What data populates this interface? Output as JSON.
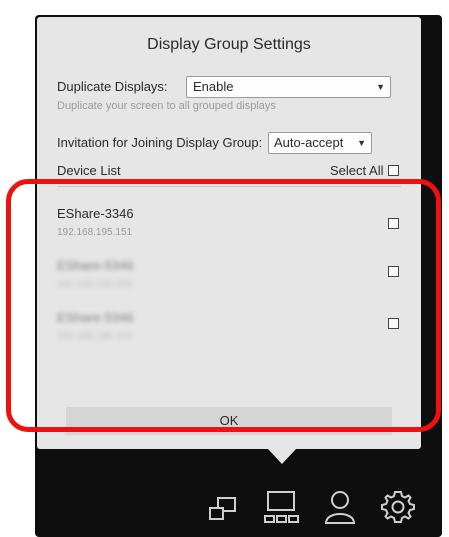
{
  "dialog": {
    "title": "Display Group Settings",
    "duplicate_label": "Duplicate Displays:",
    "duplicate_value": "Enable",
    "duplicate_hint": "Duplicate your screen to all grouped displays",
    "invitation_label": "Invitation for Joining Display Group:",
    "invitation_value": "Auto-accept",
    "device_list_label": "Device List",
    "select_all_label": "Select All",
    "ok_label": "OK"
  },
  "devices": [
    {
      "name": "EShare-3346",
      "ip": "192.168.195.151"
    },
    {
      "name": "EShare-5346",
      "ip": "192.168.195.152"
    },
    {
      "name": "EShare-5346",
      "ip": "192.168.195.153"
    }
  ],
  "colors": {
    "panel": "#e6e6e6",
    "dark_bar": "#0e0e0e",
    "highlight": "#ee1111"
  },
  "toolbar_icons": [
    "multi-window-icon",
    "display-group-icon",
    "user-icon",
    "settings-gear-icon"
  ]
}
